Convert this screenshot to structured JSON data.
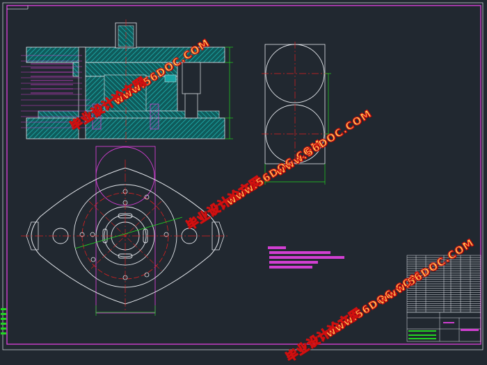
{
  "drawing": {
    "title": "",
    "colors": {
      "background": "#212830",
      "frame": "#c9cdd4",
      "border_magenta": "#d23fd2",
      "hatch_cyan": "#1aa6a6",
      "line_white": "#e6e9ee",
      "center_red": "#e02020",
      "dim_green": "#22d622",
      "leader_magenta": "#d23fd2"
    }
  },
  "watermarks": [
    {
      "cn": "毕业设计论文网",
      "url": "www.56DOC.COM"
    },
    {
      "cn": "毕业设计论文网",
      "url": "www.56DOC.COM"
    },
    {
      "cn": "毕业设计论文网",
      "url": "www.56DOC.COM"
    },
    {
      "cn": "毕业设计论文网",
      "url": "www.56DOC.COM"
    }
  ],
  "views": {
    "front_section": {
      "name": "assembly-section-view"
    },
    "top_view": {
      "name": "plan-view"
    },
    "side_view": {
      "name": "blank-side-view"
    }
  },
  "notes": {
    "technical_requirements": [
      "",
      "",
      "",
      ""
    ]
  },
  "title_block": {
    "parts_rows": 26,
    "sheet_label": ""
  }
}
